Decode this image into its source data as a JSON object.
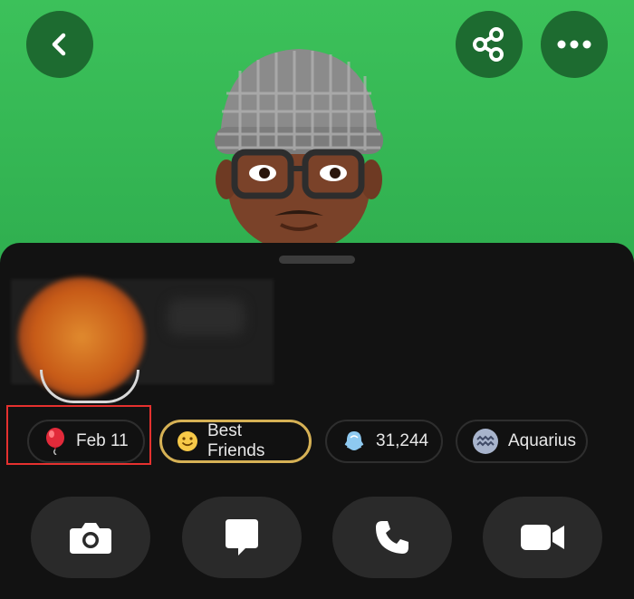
{
  "header": {
    "back_icon": "chevron-left-icon",
    "share_icon": "share-icon",
    "more_icon": "more-horizontal-icon"
  },
  "profile": {
    "bitmoji": "bitmoji-avatar"
  },
  "chips": {
    "birthday": {
      "icon": "balloon-icon",
      "label": "Feb 11"
    },
    "friendship": {
      "icon": "smiley-icon",
      "label": "Best Friends"
    },
    "score": {
      "icon": "ghost-icon",
      "label": "31,244"
    },
    "zodiac": {
      "icon": "aquarius-icon",
      "label": "Aquarius"
    }
  },
  "actions": {
    "camera_icon": "camera-icon",
    "chat_icon": "chat-icon",
    "call_icon": "phone-icon",
    "video_icon": "video-icon"
  },
  "colors": {
    "hero_green": "#3cc15a",
    "button_green": "#1d6b30",
    "sheet_bg": "#121212",
    "gold": "#d6b155",
    "highlight_red": "#e5312f"
  }
}
